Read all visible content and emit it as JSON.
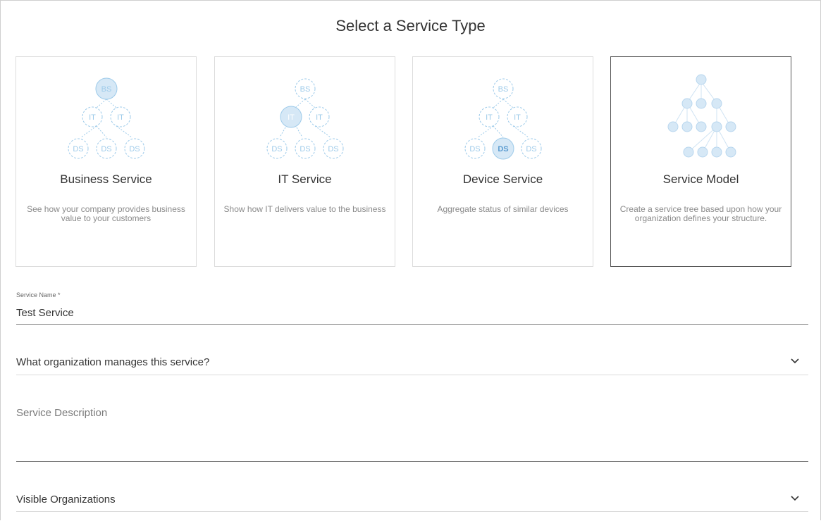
{
  "page": {
    "title": "Select a Service Type"
  },
  "service_types": [
    {
      "name": "Business Service",
      "description": "See how your company provides business value to your customers",
      "icon": "business-service-tree-icon",
      "selected": false
    },
    {
      "name": "IT Service",
      "description": "Show how IT delivers value to the business",
      "icon": "it-service-tree-icon",
      "selected": false
    },
    {
      "name": "Device Service",
      "description": "Aggregate status of similar devices",
      "icon": "device-service-tree-icon",
      "selected": false
    },
    {
      "name": "Service Model",
      "description": "Create a service tree based upon how your organization defines your structure.",
      "icon": "service-model-tree-icon",
      "selected": true
    }
  ],
  "tree_labels": {
    "bs": "BS",
    "it": "IT",
    "ds": "DS"
  },
  "form": {
    "service_name_label": "Service Name *",
    "service_name_value": "Test Service",
    "organization_placeholder": "What organization manages this service?",
    "description_placeholder": "Service Description",
    "visible_orgs_placeholder": "Visible Organizations"
  },
  "colors": {
    "icon_light": "#9ecbea",
    "icon_fill": "#d6e8f6",
    "selected_border": "#555555"
  }
}
